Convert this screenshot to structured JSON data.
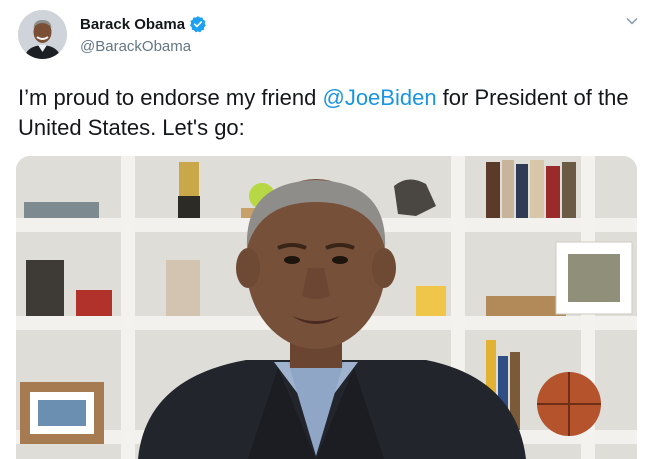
{
  "author": {
    "display_name": "Barack Obama",
    "handle": "@BarackObama",
    "verified": true,
    "avatar_icon": "profile-photo"
  },
  "tweet": {
    "text_before": "I’m proud to endorse my friend ",
    "mention": "@JoeBiden",
    "text_after": " for President of the United States. Let's go:"
  },
  "menu": {
    "icon": "chevron-down-icon"
  },
  "media": {
    "type": "video-thumbnail",
    "icon": "video-still"
  },
  "colors": {
    "text": "#14171a",
    "secondary": "#657786",
    "link": "#1b95e0",
    "verified": "#1da1f2"
  }
}
